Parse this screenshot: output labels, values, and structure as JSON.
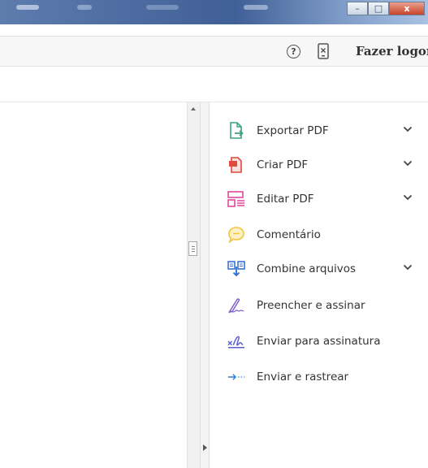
{
  "window": {
    "minimize_glyph": "–",
    "maximize_glyph": "□",
    "close_glyph": "x"
  },
  "toolbar": {
    "help_glyph": "?",
    "login_label": "Fazer logon"
  },
  "tools": [
    {
      "label": "Exportar PDF",
      "icon": "export-pdf-icon",
      "color": "#3aa37a",
      "expandable": true
    },
    {
      "label": "Criar PDF",
      "icon": "create-pdf-icon",
      "color": "#e2483d",
      "expandable": true
    },
    {
      "label": "Editar PDF",
      "icon": "edit-pdf-icon",
      "color": "#e0479e",
      "expandable": true
    },
    {
      "label": "Comentário",
      "icon": "comment-icon",
      "color": "#f3c23d",
      "expandable": false
    },
    {
      "label": "Combine arquivos",
      "icon": "combine-files-icon",
      "color": "#2c6ccf",
      "expandable": true
    },
    {
      "label": "Preencher e assinar",
      "icon": "fill-sign-icon",
      "color": "#7b60c9",
      "expandable": false
    },
    {
      "label": "Enviar para assinatura",
      "icon": "send-signature-icon",
      "color": "#5a5fcf",
      "expandable": false
    },
    {
      "label": "Enviar e rastrear",
      "icon": "send-track-icon",
      "color": "#2f7fd6",
      "expandable": false
    }
  ]
}
